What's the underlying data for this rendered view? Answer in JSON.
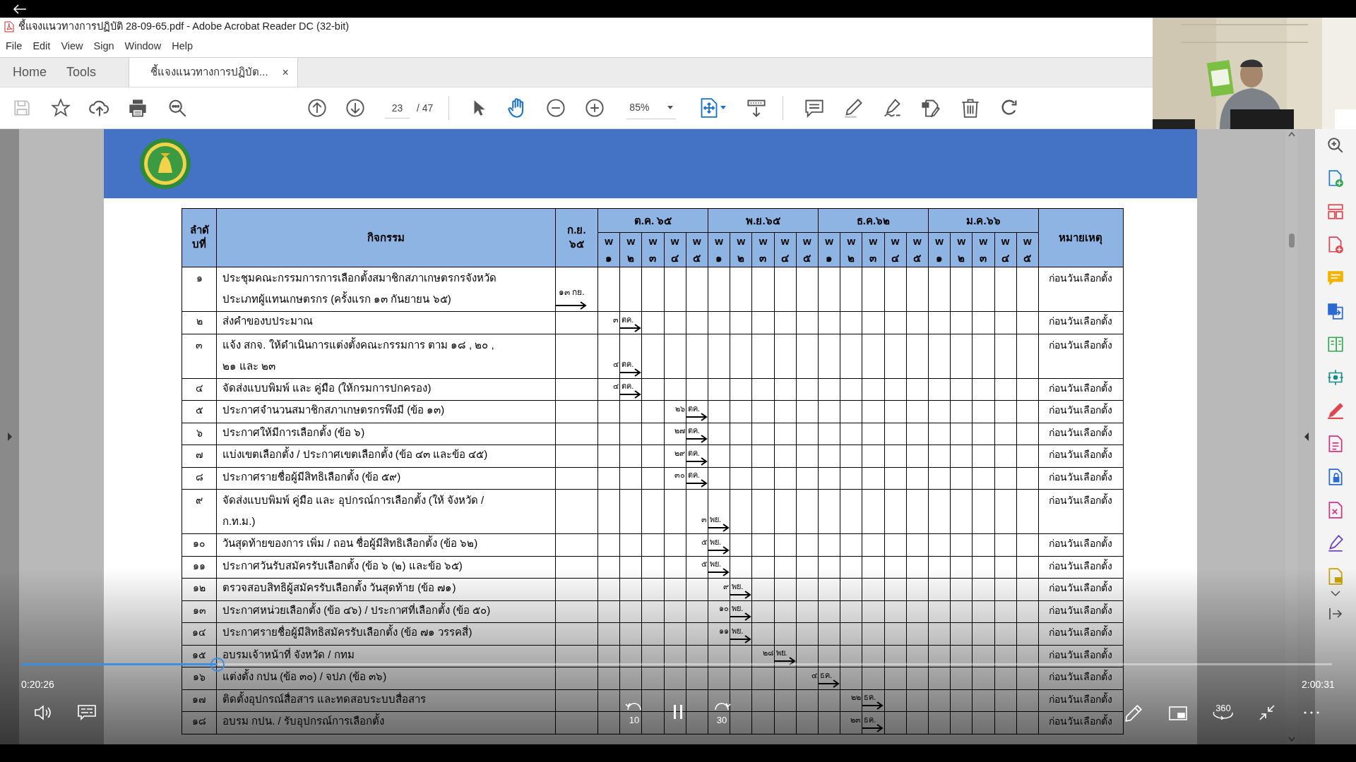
{
  "window": {
    "title": "ชี้แจงแนวทางการปฏิบัติ 28-09-65.pdf - Adobe Acrobat Reader DC (32-bit)"
  },
  "menu": [
    "File",
    "Edit",
    "View",
    "Sign",
    "Window",
    "Help"
  ],
  "tabs": [
    {
      "label": "Home",
      "selected": false
    },
    {
      "label": "Tools",
      "selected": false
    },
    {
      "label": "ชี้แจงแนวทางการปฏิบัต...",
      "selected": true,
      "close": "×"
    }
  ],
  "toolbar": {
    "page": "23",
    "page_total": "/ 47",
    "zoom": "85%"
  },
  "table": {
    "header": {
      "number": "ลำดับที่",
      "activity": "กิจกรรม",
      "first_month": "ก.ย. ๖๕",
      "months": [
        "ต.ค. ๖๕",
        "พ.ย.๖๕",
        "ธ.ค.๖๒",
        "ม.ค.๖๖"
      ],
      "weeks": [
        "w ๑",
        "w ๒",
        "w ๓",
        "w ๔",
        "w ๕",
        "w ๑",
        "w ๒",
        "w ๓",
        "w ๔",
        "w ๕",
        "w ๑",
        "w ๒",
        "w ๓",
        "w ๔",
        "w ๕",
        "w ๑",
        "w ๒",
        "w ๓",
        "w ๔",
        "w ๕"
      ],
      "remark": "หมายเหตุ"
    },
    "rows": [
      {
        "kind": "double",
        "number": "๑",
        "activity": "ประชุมคณะกรรมการการเลือกตั้งสมาชิกสภาเกษตรกรจังหวัด\nประเภทผู้แทนเกษตรกร (ครั้งแรก ๑๓ กันยายน ๖๕)",
        "date": "๑๓",
        "month": "กย.",
        "weeks": [
          true,
          false,
          false,
          false,
          false,
          false,
          false,
          false,
          false,
          false,
          false,
          false,
          false,
          false,
          false,
          false,
          false,
          false,
          false,
          false,
          false
        ],
        "remark": "ก่อนวันเลือกตั้ง"
      },
      {
        "kind": "single",
        "number": "๒",
        "activity": "ส่งคำของบประมาณ",
        "date": "๓",
        "month": "ตค.",
        "weeks": [
          false,
          false,
          true,
          false,
          false,
          false,
          false,
          false,
          false,
          false,
          false,
          false,
          false,
          false,
          false,
          false,
          false,
          false,
          false,
          false,
          false
        ],
        "remark": "ก่อนวันเลือกตั้ง"
      },
      {
        "kind": "double",
        "number": "๓",
        "activity": "แจ้ง สกจ. ให้ดำเนินการแต่งตั้งคณะกรรมการ ตาม ๑๘ , ๒๐ ,\n๒๑ และ ๒๓",
        "date": "๔",
        "month": "ตค.",
        "weeks": [
          false,
          false,
          true,
          false,
          false,
          false,
          false,
          false,
          false,
          false,
          false,
          false,
          false,
          false,
          false,
          false,
          false,
          false,
          false,
          false,
          false
        ],
        "remark": "ก่อนวันเลือกตั้ง"
      },
      {
        "kind": "single",
        "number": "๔",
        "activity": "จัดส่งแบบพิมพ์ และ คู่มือ (ให้กรมการปกครอง)",
        "date": "๔",
        "month": "ตค.",
        "weeks": [
          false,
          false,
          true,
          false,
          false,
          false,
          false,
          false,
          false,
          false,
          false,
          false,
          false,
          false,
          false,
          false,
          false,
          false,
          false,
          false,
          false
        ],
        "remark": "ก่อนวันเลือกตั้ง"
      },
      {
        "kind": "single",
        "number": "๕",
        "activity": "ประกาศจำนวนสมาชิกสภาเกษตรกรพึงมี (ข้อ ๑๓)",
        "date": "๒๖",
        "month": "ตค.",
        "weeks": [
          false,
          false,
          false,
          false,
          false,
          true,
          false,
          false,
          false,
          false,
          false,
          false,
          false,
          false,
          false,
          false,
          false,
          false,
          false,
          false,
          false
        ],
        "remark": "ก่อนวันเลือกตั้ง"
      },
      {
        "kind": "single",
        "number": "๖",
        "activity": "ประกาศให้มีการเลือกตั้ง (ข้อ ๖)",
        "date": "๒๗",
        "month": "ตค.",
        "weeks": [
          false,
          false,
          false,
          false,
          false,
          true,
          false,
          false,
          false,
          false,
          false,
          false,
          false,
          false,
          false,
          false,
          false,
          false,
          false,
          false,
          false
        ],
        "remark": "ก่อนวันเลือกตั้ง"
      },
      {
        "kind": "single",
        "number": "๗",
        "activity": "แบ่งเขตเลือกตั้ง / ประกาศเขตเลือกตั้ง (ข้อ ๔๓ และข้อ ๔๕)",
        "date": "๒๙",
        "month": "ตค.",
        "weeks": [
          false,
          false,
          false,
          false,
          false,
          true,
          false,
          false,
          false,
          false,
          false,
          false,
          false,
          false,
          false,
          false,
          false,
          false,
          false,
          false,
          false
        ],
        "remark": "ก่อนวันเลือกตั้ง"
      },
      {
        "kind": "single",
        "number": "๘",
        "activity": "ประกาศรายชื่อผู้มีสิทธิเลือกตั้ง (ข้อ ๕๙)",
        "date": "๓๐",
        "month": "ตค.",
        "weeks": [
          false,
          false,
          false,
          false,
          false,
          true,
          false,
          false,
          false,
          false,
          false,
          false,
          false,
          false,
          false,
          false,
          false,
          false,
          false,
          false,
          false
        ],
        "remark": "ก่อนวันเลือกตั้ง"
      },
      {
        "kind": "double",
        "number": "๙",
        "activity": "จัดส่งแบบพิมพ์ คู่มือ และ อุปกรณ์การเลือกตั้ง    (ให้ จังหวัด /\nก.ท.ม.)",
        "date": "๓",
        "month": "พย.",
        "weeks": [
          false,
          false,
          false,
          false,
          false,
          false,
          true,
          false,
          false,
          false,
          false,
          false,
          false,
          false,
          false,
          false,
          false,
          false,
          false,
          false,
          false
        ],
        "remark": "ก่อนวันเลือกตั้ง"
      },
      {
        "kind": "single",
        "number": "๑๐",
        "activity": "วันสุดท้ายของการ เพิ่ม / ถอน ชื่อผู้มีสิทธิเลือกตั้ง (ข้อ ๖๒)",
        "date": "๕",
        "month": "พย.",
        "weeks": [
          false,
          false,
          false,
          false,
          false,
          false,
          true,
          false,
          false,
          false,
          false,
          false,
          false,
          false,
          false,
          false,
          false,
          false,
          false,
          false,
          false
        ],
        "remark": "ก่อนวันเลือกตั้ง"
      },
      {
        "kind": "single",
        "number": "๑๑",
        "activity": "ประกาศวันรับสมัครรับเลือกตั้ง (ข้อ ๖ (๒) และข้อ ๖๕)",
        "date": "๕",
        "month": "พย.",
        "weeks": [
          false,
          false,
          false,
          false,
          false,
          false,
          true,
          false,
          false,
          false,
          false,
          false,
          false,
          false,
          false,
          false,
          false,
          false,
          false,
          false,
          false
        ],
        "remark": "ก่อนวันเลือกตั้ง"
      },
      {
        "kind": "single",
        "number": "๑๒",
        "activity": "ตรวจสอบสิทธิผู้สมัครรับเลือกตั้ง วันสุดท้าย (ข้อ ๗๑)",
        "date": "๙",
        "month": "พย.",
        "weeks": [
          false,
          false,
          false,
          false,
          false,
          false,
          false,
          true,
          false,
          false,
          false,
          false,
          false,
          false,
          false,
          false,
          false,
          false,
          false,
          false,
          false
        ],
        "remark": "ก่อนวันเลือกตั้ง"
      },
      {
        "kind": "single",
        "number": "๑๓",
        "activity": "ประกาศหน่วยเลือกตั้ง (ข้อ ๔๖)  / ประกาศที่เลือกตั้ง (ข้อ ๕๐)",
        "date": "๑๐",
        "month": "พย.",
        "weeks": [
          false,
          false,
          false,
          false,
          false,
          false,
          false,
          true,
          false,
          false,
          false,
          false,
          false,
          false,
          false,
          false,
          false,
          false,
          false,
          false,
          false
        ],
        "remark": "ก่อนวันเลือกตั้ง"
      },
      {
        "kind": "single",
        "number": "๑๔",
        "activity": "ประกาศรายชื่อผู้มีสิทธิสมัครรับเลือกตั้ง (ข้อ ๗๑ วรรคสี่)",
        "date": "๑๑",
        "month": "พย.",
        "weeks": [
          false,
          false,
          false,
          false,
          false,
          false,
          false,
          true,
          false,
          false,
          false,
          false,
          false,
          false,
          false,
          false,
          false,
          false,
          false,
          false,
          false
        ],
        "remark": "ก่อนวันเลือกตั้ง"
      },
      {
        "kind": "single",
        "number": "๑๕",
        "activity": "อบรมเจ้าหน้าที่ จังหวัด / กทม",
        "date": "๒๘",
        "month": "พย.",
        "weeks": [
          false,
          false,
          false,
          false,
          false,
          false,
          false,
          false,
          false,
          true,
          false,
          false,
          false,
          false,
          false,
          false,
          false,
          false,
          false,
          false,
          false
        ],
        "remark": "ก่อนวันเลือกตั้ง"
      },
      {
        "kind": "single",
        "number": "๑๖",
        "activity": "แต่งตั้ง กปน (ข้อ ๓๐) / จปภ (ข้อ ๓๖)",
        "date": "๔",
        "month": "ธค.",
        "weeks": [
          false,
          false,
          false,
          false,
          false,
          false,
          false,
          false,
          false,
          false,
          false,
          true,
          false,
          false,
          false,
          false,
          false,
          false,
          false,
          false,
          false
        ],
        "remark": "ก่อนวันเลือกตั้ง"
      },
      {
        "kind": "single",
        "number": "๑๗",
        "activity": "ติดตั้งอุปกรณ์สื่อสาร และทดสอบระบบสื่อสาร",
        "date": "๒๒",
        "month": "ธค.",
        "weeks": [
          false,
          false,
          false,
          false,
          false,
          false,
          false,
          false,
          false,
          false,
          false,
          false,
          false,
          true,
          false,
          false,
          false,
          false,
          false,
          false,
          false
        ],
        "remark": "ก่อนวันเลือกตั้ง"
      },
      {
        "kind": "single",
        "number": "๑๘",
        "activity": "อบรม กปน. / รับอุปกรณ์การเลือกตั้ง",
        "date": "๒๓",
        "month": "ธค.",
        "weeks": [
          false,
          false,
          false,
          false,
          false,
          false,
          false,
          false,
          false,
          false,
          false,
          false,
          false,
          true,
          false,
          false,
          false,
          false,
          false,
          false,
          false
        ],
        "remark": "ก่อนวันเลือกตั้ง"
      }
    ]
  },
  "player": {
    "elapsed": "0:20:26",
    "duration": "2:00:31",
    "progress": {
      "level": 0.15
    },
    "rewind": "10",
    "forward": "30",
    "vr": "360"
  }
}
